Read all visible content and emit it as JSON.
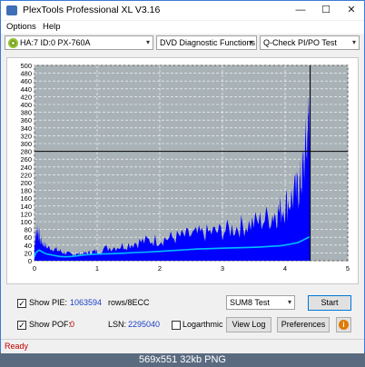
{
  "window": {
    "title": "PlexTools Professional XL V3.16",
    "minimize": "—",
    "maximize": "☐",
    "close": "✕"
  },
  "menu": {
    "options": "Options",
    "help": "Help"
  },
  "toolbar": {
    "drive": "HA:7 ID:0  PX-760A",
    "function": "DVD Diagnostic Functions",
    "test": "Q-Check PI/PO Test",
    "arrow": "▾"
  },
  "chart_data": {
    "type": "area",
    "x": [
      0,
      0.02,
      0.05,
      0.08,
      0.1,
      0.15,
      0.2,
      0.3,
      0.4,
      0.5,
      0.6,
      0.7,
      0.8,
      0.9,
      1.0,
      1.2,
      1.4,
      1.6,
      1.8,
      2.0,
      2.2,
      2.4,
      2.6,
      2.8,
      3.0,
      3.2,
      3.4,
      3.6,
      3.8,
      3.9,
      4.0,
      4.1,
      4.2,
      4.25,
      4.3,
      4.35,
      4.38,
      4.4
    ],
    "pie_max": [
      45,
      80,
      100,
      70,
      60,
      50,
      40,
      35,
      30,
      22,
      20,
      20,
      22,
      25,
      30,
      40,
      45,
      55,
      60,
      65,
      70,
      75,
      80,
      85,
      90,
      100,
      110,
      120,
      140,
      150,
      170,
      190,
      210,
      240,
      290,
      370,
      450,
      490
    ],
    "pie_avg": [
      40,
      55,
      65,
      50,
      45,
      40,
      35,
      30,
      25,
      18,
      15,
      15,
      16,
      18,
      20,
      25,
      28,
      32,
      35,
      38,
      40,
      45,
      50,
      55,
      58,
      62,
      70,
      80,
      90,
      100,
      110,
      130,
      150,
      170,
      200,
      260,
      330,
      380
    ],
    "pif_avg": [
      10,
      20,
      25,
      27,
      25,
      20,
      17,
      14,
      11,
      10,
      11,
      13,
      15,
      16,
      17,
      18,
      19,
      21,
      22,
      24,
      26,
      28,
      30,
      31,
      32,
      33,
      34,
      35,
      37,
      38,
      40,
      43,
      46,
      50,
      54,
      58,
      60,
      61
    ],
    "xlim": [
      0,
      5
    ],
    "ylim": [
      0,
      500
    ],
    "yticks": [
      0,
      20,
      40,
      60,
      80,
      100,
      120,
      140,
      160,
      180,
      200,
      220,
      240,
      260,
      280,
      300,
      320,
      340,
      360,
      380,
      400,
      420,
      440,
      460,
      480,
      500
    ],
    "xticks": [
      0,
      1,
      2,
      3,
      4,
      5
    ],
    "threshold": 280,
    "colors": {
      "pie": "#0000ff",
      "pif": "#00bfff",
      "bg": "#a9b3b7",
      "threshold": "#000000"
    },
    "grid": true
  },
  "controls": {
    "show_pie_label": "Show PIE:",
    "pie_value": "1063594",
    "pie_unit": "rows/8ECC",
    "show_pof_label": "Show POF:",
    "pof_value": "0",
    "lsn_label": "LSN:",
    "lsn_value": "2295040",
    "logarithmic_label": "Logarthmic",
    "test_mode": "SUM8 Test",
    "start_label": "Start",
    "viewlog_label": "View Log",
    "preferences_label": "Preferences",
    "show_pie_checked": "✓",
    "show_pof_checked": "✓"
  },
  "status": {
    "text": "Ready"
  },
  "caption": {
    "text": "569x551  32kb  PNG"
  }
}
